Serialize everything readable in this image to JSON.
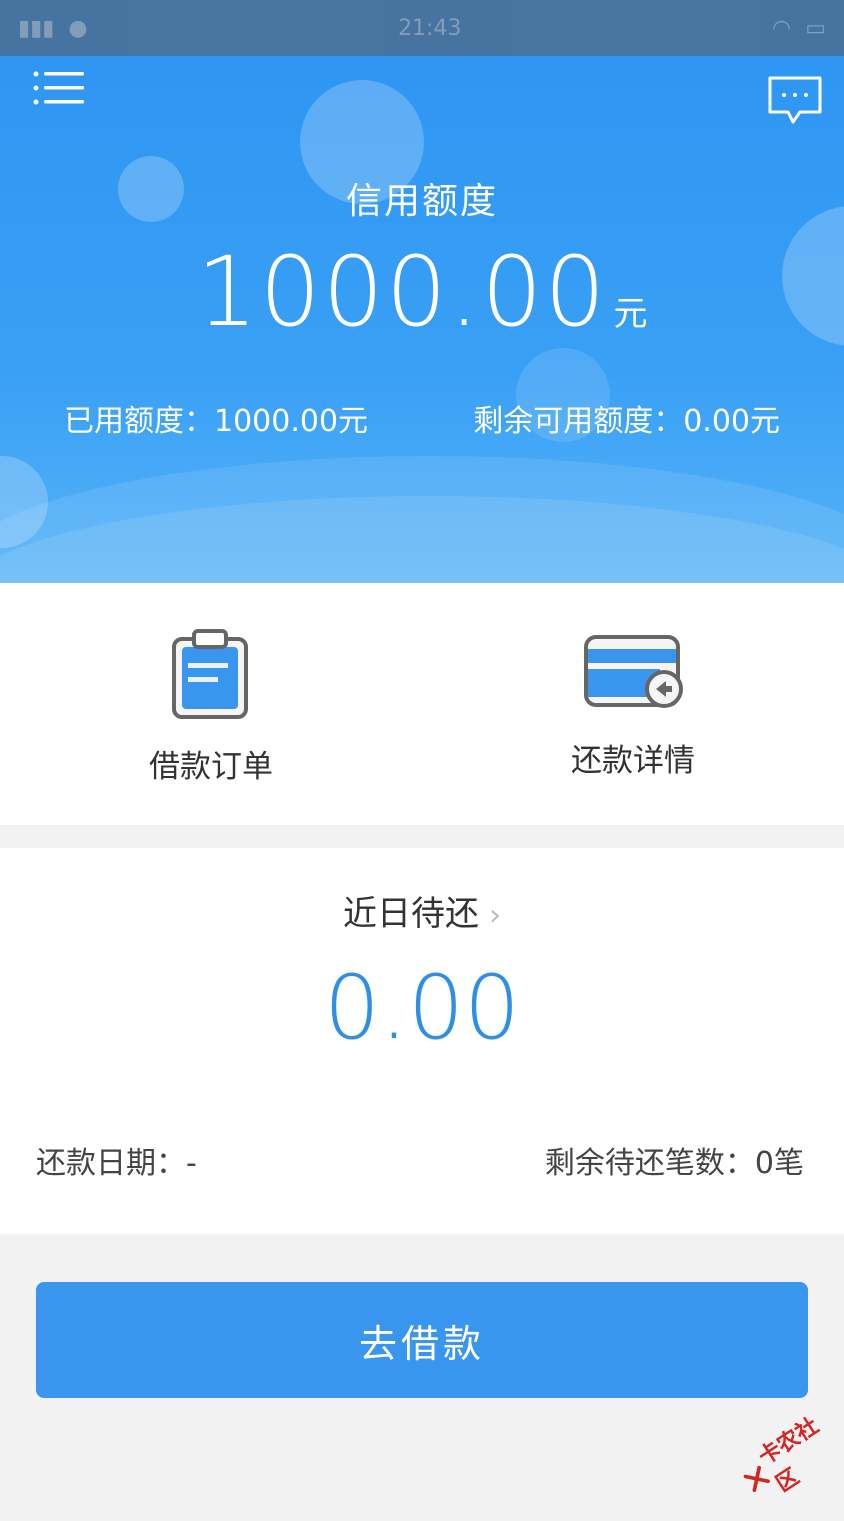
{
  "status_bar": {
    "time": "21:43"
  },
  "hero": {
    "title": "信用额度",
    "amount": "1000.00",
    "unit": "元",
    "used": "已用额度：1000.00元",
    "remaining": "剩余可用额度：0.00元"
  },
  "quick_actions": [
    {
      "label": "借款订单",
      "icon": "clipboard-icon"
    },
    {
      "label": "还款详情",
      "icon": "card-icon"
    }
  ],
  "due": {
    "title": "近日待还",
    "amount": "0.00",
    "date": "还款日期：-",
    "count": "剩余待还笔数：0笔"
  },
  "cta": {
    "label": "去借款"
  },
  "watermark": {
    "text": "卡农社区"
  },
  "colors": {
    "primary": "#3a95ee",
    "hero_bg": "#2e96f2",
    "amount_blue": "#2e8fe8",
    "watermark_red": "#d42424"
  }
}
